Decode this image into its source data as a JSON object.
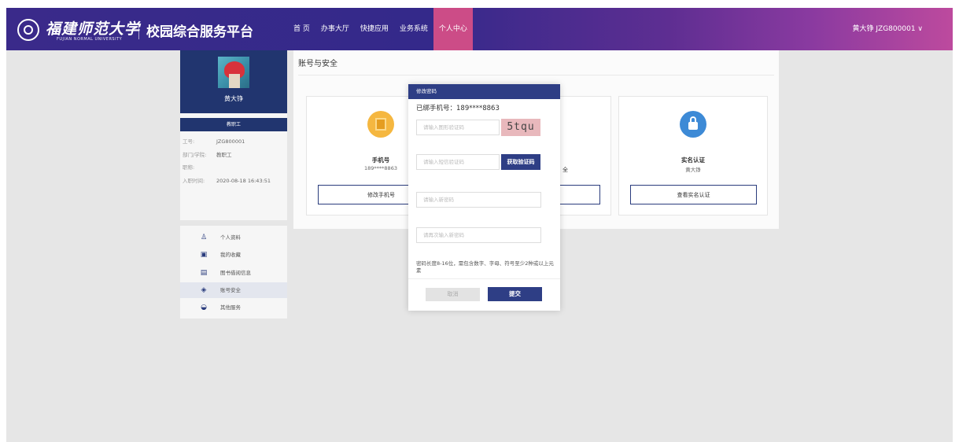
{
  "header": {
    "university_name_cn": "福建师范大学",
    "university_name_en": "FUJIAN NORMAL UNIVERSITY",
    "platform_title": "校园综合服务平台",
    "nav": [
      "首 页",
      "办事大厅",
      "快捷应用",
      "业务系统",
      "个人中心"
    ],
    "active_nav": "个人中心",
    "user_menu": "黄大铮 JZG800001 ∨",
    "gradient_colors": [
      "#3a2a8a",
      "#5e2e92",
      "#bd4a9e"
    ]
  },
  "profile": {
    "name": "黄大铮",
    "role": "教职工",
    "rows": [
      {
        "label": "工号:",
        "value": "JZG800001"
      },
      {
        "label": "部门/学院:",
        "value": "教职工"
      },
      {
        "label": "职称:",
        "value": ""
      },
      {
        "label": "入职时间:",
        "value": "2020-08-18 16:43:51"
      }
    ]
  },
  "menu": {
    "items": [
      {
        "label": "个人资料",
        "icon": "user-icon"
      },
      {
        "label": "我的收藏",
        "icon": "bookmark-icon"
      },
      {
        "label": "图书借阅信息",
        "icon": "book-icon"
      },
      {
        "label": "账号安全",
        "icon": "shield-icon"
      },
      {
        "label": "其他服务",
        "icon": "service-icon"
      }
    ],
    "active": "账号安全"
  },
  "content": {
    "title": "账号与安全",
    "cards": [
      {
        "name": "手机号",
        "value": "189****8863",
        "button": "修改手机号",
        "icon": "phone-icon"
      },
      {
        "name": "",
        "value": "",
        "button": "",
        "partial": "全",
        "icon": ""
      },
      {
        "name": "实名认证",
        "value": "黄大铮",
        "button": "查看实名认证",
        "icon": "lock-icon"
      }
    ]
  },
  "dialog": {
    "title": "修改密码",
    "bound_phone": "已绑手机号：189****8863",
    "captcha_placeholder": "请输入图形验证码",
    "captcha_text": "5tqu",
    "sms_placeholder": "请输入短信验证码",
    "sms_button": "获取验证码",
    "new_password_placeholder": "请输入新密码",
    "confirm_password_placeholder": "请再次输入新密码",
    "rule": "密码长度8-16位，需包含数字、字母、符号至少2种或以上元素",
    "cancel": "取消",
    "submit": "提交"
  }
}
